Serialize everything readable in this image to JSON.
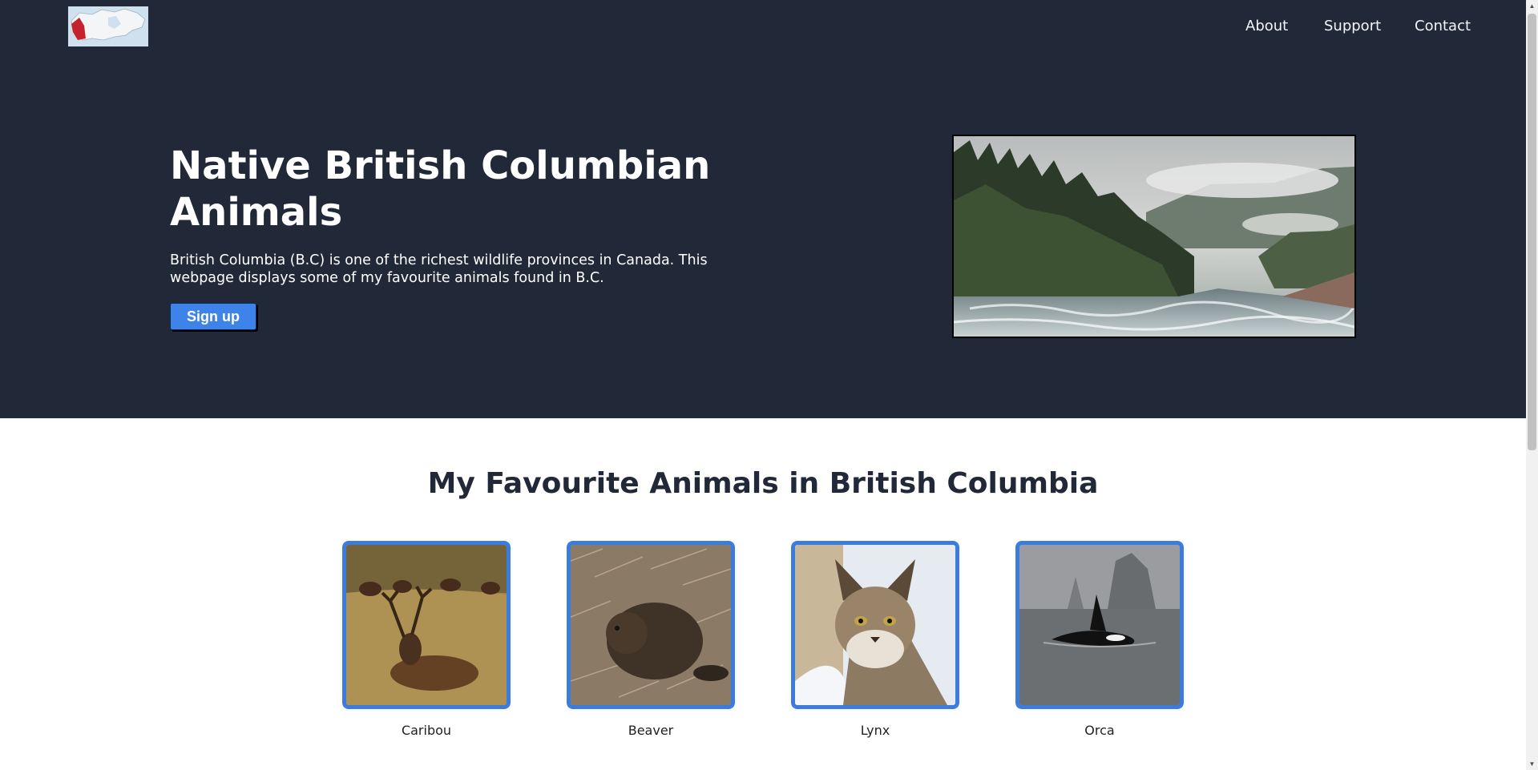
{
  "logo": {
    "icon": "canada-map-icon",
    "colors": {
      "highlight": "#c4232e",
      "land": "#f4f5f6",
      "water": "#cfe0ee"
    }
  },
  "nav": {
    "items": [
      {
        "label": "About"
      },
      {
        "label": "Support"
      },
      {
        "label": "Contact"
      }
    ]
  },
  "hero": {
    "title": "Native British Columbian Animals",
    "description": "British Columbia (B.C) is one of the richest wildlife provinces in Canada. This webpage displays some of my favourite animals found in B.C.",
    "signup_label": "Sign up",
    "image": "forest-river-landscape-icon",
    "background": "#212838",
    "accent": "#3e83ea"
  },
  "section": {
    "title": "My Favourite Animals in British Columbia",
    "animals": [
      {
        "name": "Caribou",
        "icon": "caribou-photo-icon"
      },
      {
        "name": "Beaver",
        "icon": "beaver-photo-icon"
      },
      {
        "name": "Lynx",
        "icon": "lynx-photo-icon"
      },
      {
        "name": "Orca",
        "icon": "orca-photo-icon"
      }
    ],
    "card_border_color": "#3b7ddf"
  }
}
